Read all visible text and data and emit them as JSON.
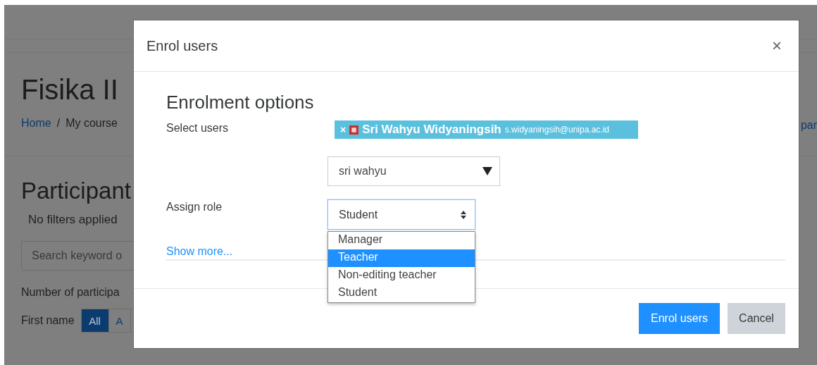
{
  "page": {
    "course_title": "Fisika II",
    "breadcrumb": [
      {
        "label": "Home",
        "kind": "link"
      },
      {
        "label": "/",
        "kind": "separator"
      },
      {
        "label": "My course",
        "kind": "text"
      }
    ],
    "right_link": "par",
    "section_title": "Participant",
    "filter_note": "No filters applied",
    "search": {
      "placeholder": "Search keyword o"
    },
    "count_label": "Number of participa",
    "initials_label": "First name",
    "initials": [
      {
        "label": "All",
        "selected": true
      },
      {
        "label": "A",
        "selected": false
      }
    ]
  },
  "modal": {
    "title": "Enrol users",
    "close": "×",
    "heading": "Enrolment options",
    "select_users": {
      "label": "Select users",
      "chips": [
        {
          "remove": "×",
          "name": "Sri Wahyu Widyaningsih",
          "email": "s.widyaningsih@unipa.ac.id"
        }
      ],
      "search_value": "sri wahyu"
    },
    "assign_role": {
      "label": "Assign role",
      "value": "Student",
      "expanded": true,
      "options": [
        {
          "label": "Manager",
          "highlighted": false
        },
        {
          "label": "Teacher",
          "highlighted": true
        },
        {
          "label": "Non-editing teacher",
          "highlighted": false
        },
        {
          "label": "Student",
          "highlighted": false
        }
      ]
    },
    "show_more": "Show more...",
    "buttons": [
      {
        "label": "Enrol users",
        "kind": "primary"
      },
      {
        "label": "Cancel",
        "kind": "secondary"
      }
    ]
  }
}
